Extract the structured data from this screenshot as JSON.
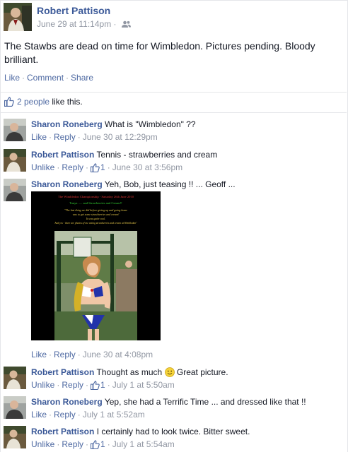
{
  "post": {
    "author": "Robert Pattison",
    "timestamp": "June 29 at 11:14pm",
    "audience_icon": "friends-icon",
    "text": "The Stawbs are dead on time for Wimbledon. Pictures pending. Bloody brilliant.",
    "actions": {
      "like": "Like",
      "comment": "Comment",
      "share": "Share"
    },
    "likes": {
      "count_link": "2 people",
      "suffix": " like this."
    }
  },
  "comments": [
    {
      "author": "Sharon Roneberg",
      "text": "What is \"Wimbledon\" ??",
      "action": "Like",
      "reply": "Reply",
      "likes": "",
      "time": "June 30 at 12:29pm"
    },
    {
      "author": "Robert Pattison",
      "text": "Tennis - strawberries and cream",
      "action": "Unlike",
      "reply": "Reply",
      "likes": "1",
      "time": "June 30 at 3:56pm"
    },
    {
      "author": "Sharon Roneberg",
      "text": "Yeh, Bob, just teasing !! ... Geoff ...",
      "action": "Like",
      "reply": "Reply",
      "likes": "",
      "time": "June 30 at 4:08pm",
      "attachment": {
        "banner": "The Wimbledon Championship - Saturday 26th June 2010",
        "title": "Tanya ..... and Strawberries and Cream!!",
        "caption_1": "\"The last thing we did before giving up and going home",
        "caption_2": "was to get some strawberries and cream!",
        "caption_3": "It was quite cool.",
        "caption_4": "And yes - there are photos of me eating strawberries and cream at Wimbledon\""
      }
    },
    {
      "author": "Robert Pattison",
      "text": "Thought as much",
      "text_after": " Great picture.",
      "emoji": "smiley-emoji",
      "action": "Unlike",
      "reply": "Reply",
      "likes": "1",
      "time": "July 1 at 5:50am"
    },
    {
      "author": "Sharon Roneberg",
      "text": "Yep, she had a Terrific Time ... and dressed like that !!",
      "action": "Like",
      "reply": "Reply",
      "likes": "",
      "time": "July 1 at 5:52am"
    },
    {
      "author": "Robert Pattison",
      "text": "I certainly had to look twice. Bitter sweet.",
      "action": "Unlike",
      "reply": "Reply",
      "likes": "1",
      "time": "July 1 at 5:54am"
    }
  ],
  "colors": {
    "link": "#4e69a2",
    "name": "#3b5998",
    "meta": "#9197a3",
    "divider": "#e5e6e9"
  }
}
